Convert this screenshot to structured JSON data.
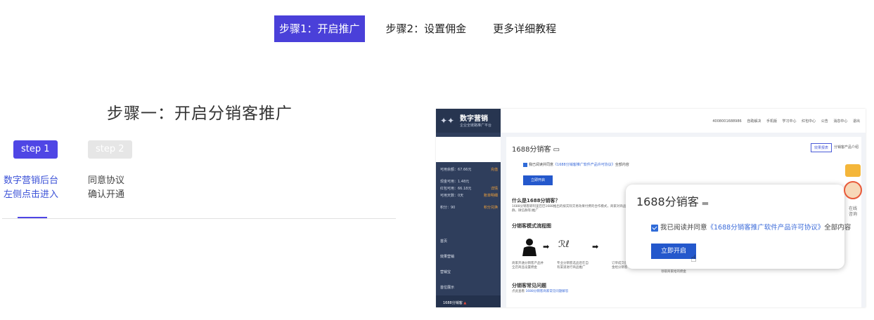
{
  "nav": {
    "tabs": [
      {
        "label": "步骤1：开启推广",
        "active": true
      },
      {
        "label": "步骤2：设置佣金",
        "active": false
      },
      {
        "label": "更多详细教程",
        "active": false
      }
    ]
  },
  "main": {
    "title": "步骤一：开启分销客推广",
    "step1": "step 1",
    "step2": "step 2",
    "desc_left": [
      "数字营销后台",
      "左侧点击进入"
    ],
    "desc_right": [
      "同意协议",
      "确认开通"
    ]
  },
  "screenshot": {
    "logo_name": "数字营销",
    "logo_sub": "企业全链路推广平台",
    "stats": [
      {
        "label": "可用余额：67.66元",
        "action": "充值"
      },
      {
        "label": "现金可用：1.48元",
        "action": ""
      },
      {
        "label": "红包可用：66.18元",
        "action": "详情"
      },
      {
        "label": "可用天数：0天",
        "action": "账单明细"
      },
      {
        "label": "积分：90",
        "action": "积分兑换"
      }
    ],
    "menu": [
      "首页",
      "效果营销",
      "营销宝",
      "首位展示",
      "1688分销客"
    ],
    "topbar_links": [
      "4008001688986",
      "自助解决",
      "手机版",
      "学习中心",
      "红包中心",
      "公告",
      "消息中心",
      "退出"
    ],
    "page_title": "1688分销客",
    "effect_tab": "效果报表",
    "product_intro": "分销客产品介绍",
    "agree_prefix": "我已阅读并同意",
    "agree_link": "《1688分销客推广软件产品许可协议》",
    "agree_suffix": "全部内容",
    "open_button": "立即开启",
    "what_is_title": "什么是1688分销客？",
    "what_is_text": "1688分销客即阿里巴巴1688推出的按实际交易效果付费的合作模式，商家对商品设置佣金，分销客选品后在自有渠道(如QQ群，微信群等)推广",
    "flow_title": "分销客模式流程图",
    "flow_steps": [
      "商家开通分销客产品并全店商品设置佣金",
      "专业分销客选品后在自有渠道进行商品推广",
      "订单成交后按比例支付佣金给分销客",
      "领取商家给的佣金"
    ],
    "faq_title": "分销客常见问题",
    "faq_link_prefix": "点此查看",
    "faq_link": "1688分销客商家常见问题解答"
  },
  "popup": {
    "title": "1688分销客",
    "agree_prefix": "我已阅读并同意",
    "agree_link": "《1688分销客推广软件产品许可协议》",
    "agree_suffix": "全部内容",
    "button": "立即开启"
  },
  "float": {
    "text_1": "在线",
    "text_2": "咨询"
  }
}
